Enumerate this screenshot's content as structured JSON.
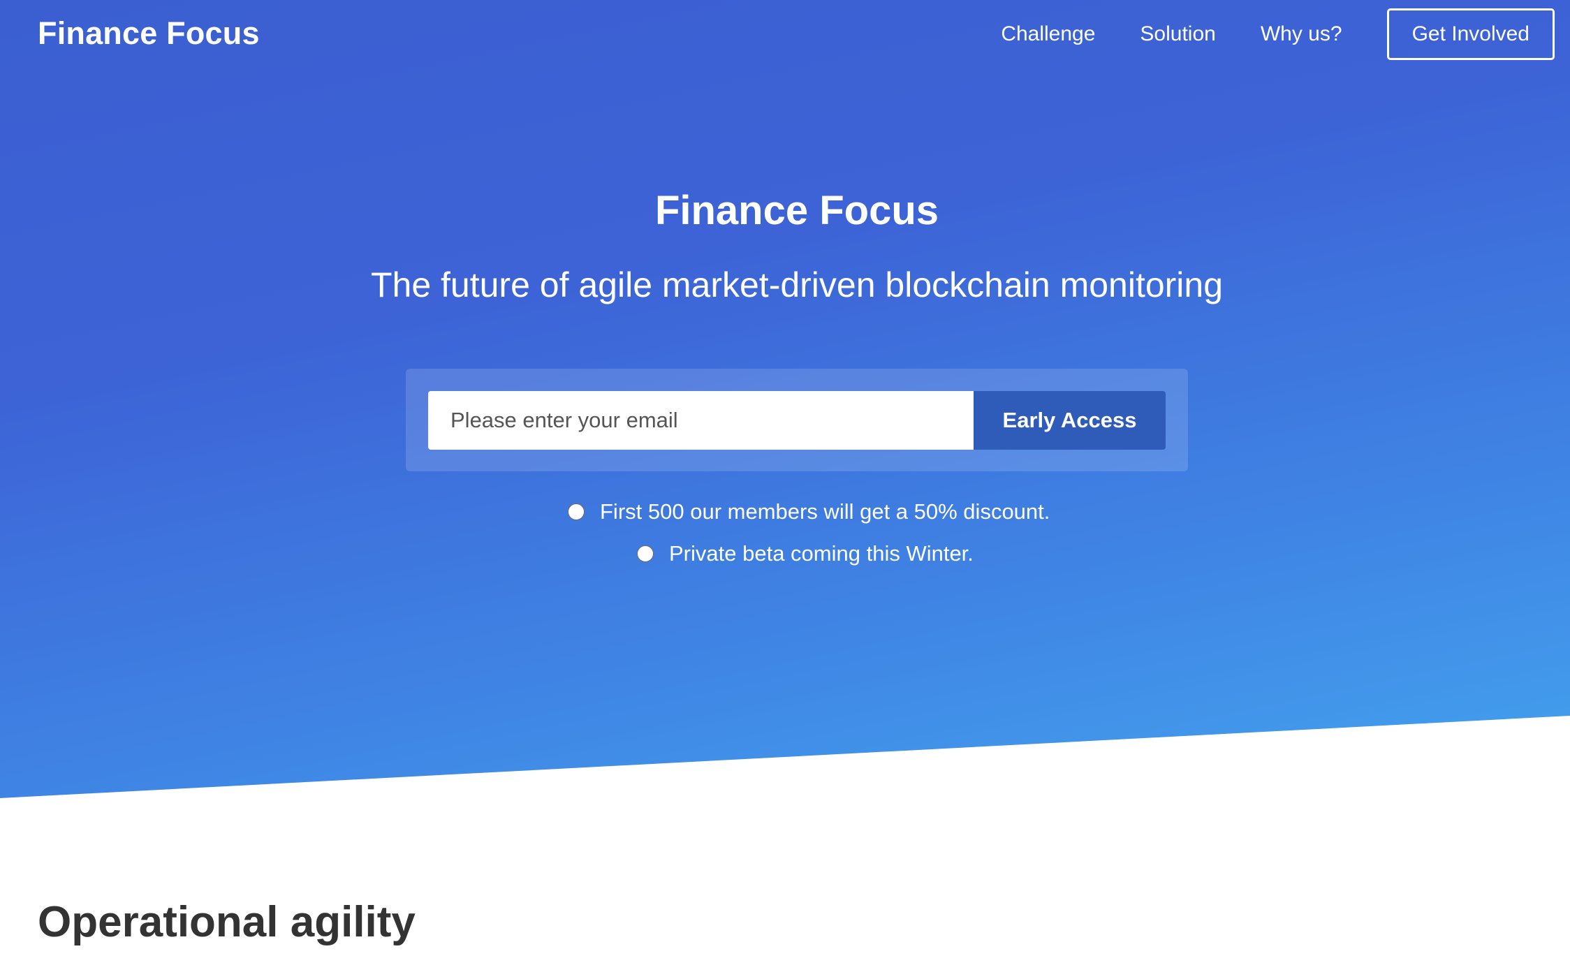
{
  "header": {
    "brand": "Finance Focus",
    "nav": [
      {
        "label": "Challenge"
      },
      {
        "label": "Solution"
      },
      {
        "label": "Why us?"
      }
    ],
    "cta_label": "Get Involved"
  },
  "hero": {
    "title": "Finance Focus",
    "subtitle": "The future of agile market-driven blockchain monitoring",
    "signup": {
      "email_placeholder": "Please enter your email",
      "email_value": "",
      "button_label": "Early Access"
    },
    "perks": [
      {
        "text": "First 500 our members will get a 50% discount."
      },
      {
        "text": "Private beta coming this Winter."
      }
    ]
  },
  "sections": [
    {
      "title": "Operational agility"
    }
  ],
  "colors": {
    "hero_gradient_top": "#3b5fd1",
    "hero_gradient_bottom": "#44a3ee",
    "button_bg": "#2f5cb8",
    "section_title": "#333333"
  }
}
